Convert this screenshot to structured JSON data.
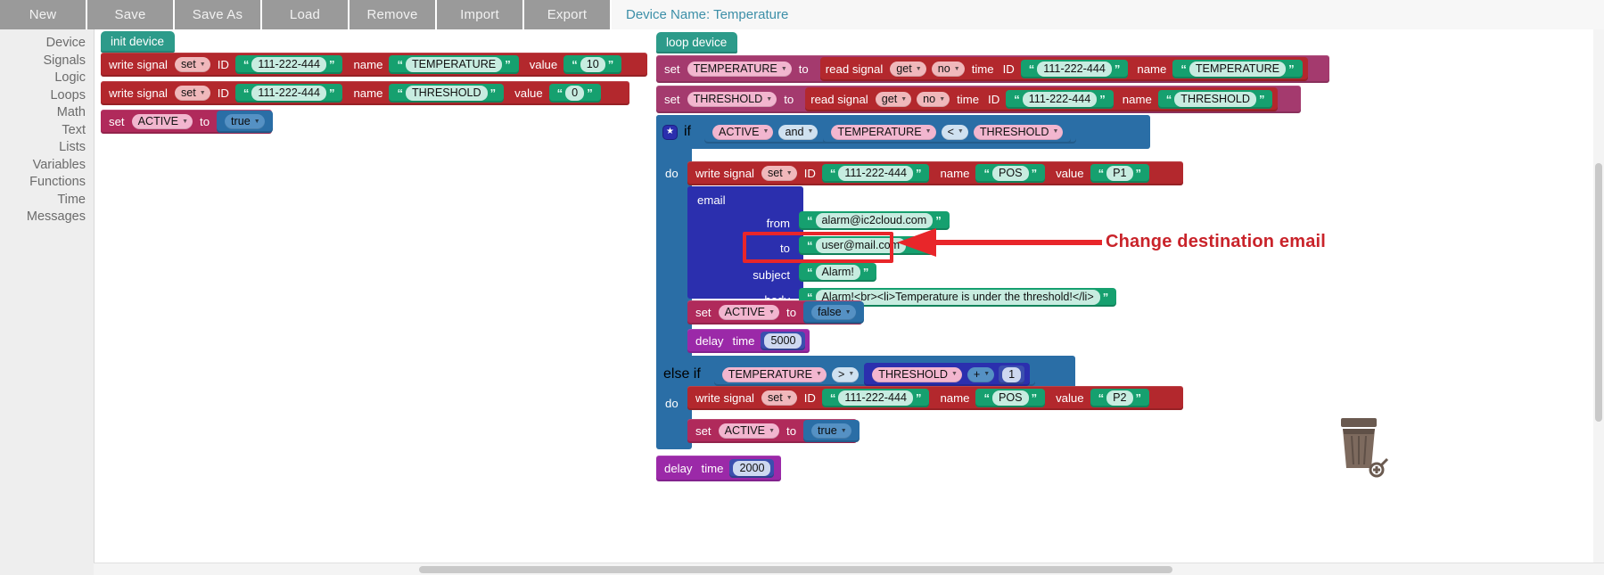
{
  "toolbar": {
    "buttons": [
      "New",
      "Save",
      "Save As",
      "Load",
      "Remove",
      "Import",
      "Export"
    ],
    "device_name_label": "Device Name: Temperature"
  },
  "sidebar": {
    "items": [
      "Device",
      "Signals",
      "Logic",
      "Loops",
      "Math",
      "Text",
      "Lists",
      "Variables",
      "Functions",
      "Time",
      "Messages"
    ]
  },
  "annotation": {
    "text": "Change destination email",
    "color": "#c9232a",
    "highlight_color": "#e8262a"
  },
  "workspace": {
    "init": {
      "hat_label": "init device",
      "rows": [
        {
          "op": "write signal",
          "mode": "set",
          "id_label": "ID",
          "id_value": "111-222-444",
          "name_label": "name",
          "name_value": "TEMPERATURE",
          "value_label": "value",
          "value_value": "10"
        },
        {
          "op": "write signal",
          "mode": "set",
          "id_label": "ID",
          "id_value": "111-222-444",
          "name_label": "name",
          "name_value": "THRESHOLD",
          "value_label": "value",
          "value_value": "0"
        }
      ],
      "set_row": {
        "set_label": "set",
        "variable": "ACTIVE",
        "to_label": "to",
        "value": "true"
      }
    },
    "loop": {
      "hat_label": "loop device",
      "set_rows": [
        {
          "set_label": "set",
          "variable": "TEMPERATURE",
          "to_label": "to",
          "read_op": "read signal",
          "read_mode": "get",
          "read_time": "no",
          "time_label": "time",
          "id_label": "ID",
          "id_value": "111-222-444",
          "name_label": "name",
          "name_value": "TEMPERATURE"
        },
        {
          "set_label": "set",
          "variable": "THRESHOLD",
          "to_label": "to",
          "read_op": "read signal",
          "read_mode": "get",
          "read_time": "no",
          "time_label": "time",
          "id_label": "ID",
          "id_value": "111-222-444",
          "name_label": "name",
          "name_value": "THRESHOLD"
        }
      ],
      "if_block": {
        "if_label": "if",
        "cond_var": "ACTIVE",
        "logic_op": "and",
        "cond2_left": "TEMPERATURE",
        "cond2_op": "<",
        "cond2_right": "THRESHOLD",
        "do_label": "do",
        "write": {
          "op": "write signal",
          "mode": "set",
          "id_label": "ID",
          "id_value": "111-222-444",
          "name_label": "name",
          "name_value": "POS",
          "value_label": "value",
          "value_value": "P1"
        },
        "email": {
          "title": "email",
          "from_label": "from",
          "from_value": "alarm@ic2cloud.com",
          "to_label": "to",
          "to_value": "user@mail.com",
          "subject_label": "subject",
          "subject_value": "Alarm!",
          "body_label": "body",
          "body_value": "Alarm!<br><li>Temperature is under the threshold!</li>"
        },
        "set_active": {
          "set_label": "set",
          "variable": "ACTIVE",
          "to_label": "to",
          "value": "false"
        },
        "delay": {
          "delay_label": "delay",
          "time_label": "time",
          "value": "5000"
        },
        "else_if_label": "else if",
        "else_cond_left": "TEMPERATURE",
        "else_cond_op": ">",
        "else_cond_right": "THRESHOLD",
        "else_math_op": "+",
        "else_math_value": "1",
        "else_do_label": "do",
        "else_write": {
          "op": "write signal",
          "mode": "set",
          "id_label": "ID",
          "id_value": "111-222-444",
          "name_label": "name",
          "name_value": "POS",
          "value_label": "value",
          "value_value": "P2"
        },
        "else_set_active": {
          "set_label": "set",
          "variable": "ACTIVE",
          "to_label": "to",
          "value": "true"
        }
      },
      "final_delay": {
        "delay_label": "delay",
        "time_label": "time",
        "value": "2000"
      }
    }
  }
}
